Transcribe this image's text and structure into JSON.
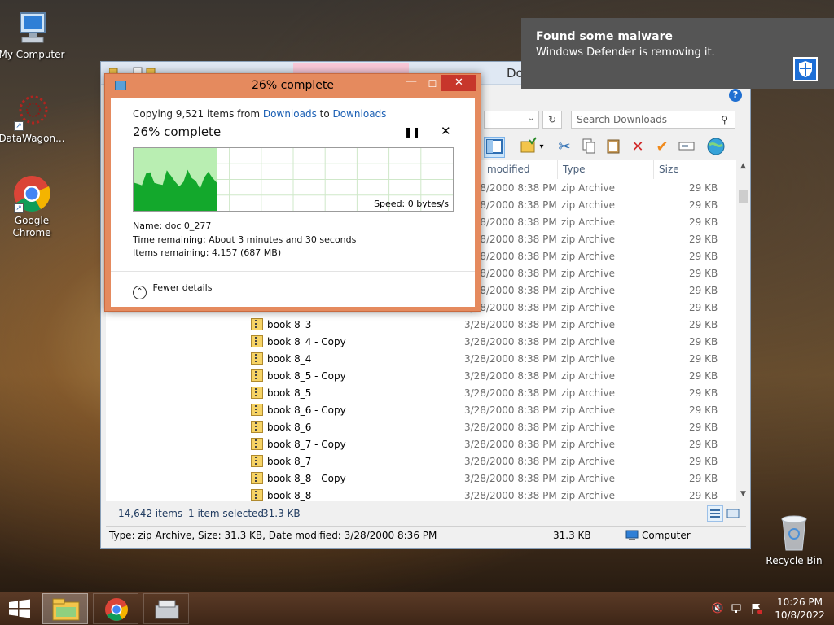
{
  "desktop": {
    "icons": [
      {
        "label": "My Computer"
      },
      {
        "label": "DataWagon..."
      },
      {
        "label": "Google Chrome"
      },
      {
        "label": "Recycle Bin"
      }
    ]
  },
  "explorer": {
    "title": "Do",
    "search_placeholder": "Search Downloads",
    "columns": {
      "date": "modified",
      "type": "Type",
      "size": "Size"
    },
    "top_rows": [
      {
        "date": "3/28/2000 8:38 PM",
        "type": "zip Archive",
        "size": "29 KB"
      },
      {
        "date": "3/28/2000 8:38 PM",
        "type": "zip Archive",
        "size": "29 KB"
      },
      {
        "date": "3/28/2000 8:38 PM",
        "type": "zip Archive",
        "size": "29 KB"
      },
      {
        "date": "3/28/2000 8:38 PM",
        "type": "zip Archive",
        "size": "29 KB"
      },
      {
        "date": "3/28/2000 8:38 PM",
        "type": "zip Archive",
        "size": "29 KB"
      },
      {
        "date": "3/28/2000 8:38 PM",
        "type": "zip Archive",
        "size": "29 KB"
      },
      {
        "date": "3/28/2000 8:38 PM",
        "type": "zip Archive",
        "size": "29 KB"
      },
      {
        "date": "3/28/2000 8:38 PM",
        "type": "zip Archive",
        "size": "29 KB"
      }
    ],
    "rows": [
      {
        "name": "book 8_3",
        "date": "3/28/2000 8:38 PM",
        "type": "zip Archive",
        "size": "29 KB"
      },
      {
        "name": "book 8_4 - Copy",
        "date": "3/28/2000 8:38 PM",
        "type": "zip Archive",
        "size": "29 KB"
      },
      {
        "name": "book 8_4",
        "date": "3/28/2000 8:38 PM",
        "type": "zip Archive",
        "size": "29 KB"
      },
      {
        "name": "book 8_5 - Copy",
        "date": "3/28/2000 8:38 PM",
        "type": "zip Archive",
        "size": "29 KB"
      },
      {
        "name": "book 8_5",
        "date": "3/28/2000 8:38 PM",
        "type": "zip Archive",
        "size": "29 KB"
      },
      {
        "name": "book 8_6 - Copy",
        "date": "3/28/2000 8:38 PM",
        "type": "zip Archive",
        "size": "29 KB"
      },
      {
        "name": "book 8_6",
        "date": "3/28/2000 8:38 PM",
        "type": "zip Archive",
        "size": "29 KB"
      },
      {
        "name": "book 8_7 - Copy",
        "date": "3/28/2000 8:38 PM",
        "type": "zip Archive",
        "size": "29 KB"
      },
      {
        "name": "book 8_7",
        "date": "3/28/2000 8:38 PM",
        "type": "zip Archive",
        "size": "29 KB"
      },
      {
        "name": "book 8_8 - Copy",
        "date": "3/28/2000 8:38 PM",
        "type": "zip Archive",
        "size": "29 KB"
      },
      {
        "name": "book 8_8",
        "date": "3/28/2000 8:38 PM",
        "type": "zip Archive",
        "size": "29 KB"
      }
    ],
    "status": {
      "items": "14,642 items",
      "selected": "1 item selected",
      "selected_size": "31.3 KB"
    },
    "details_bar": {
      "info": "Type: zip Archive, Size: 31.3 KB, Date modified: 3/28/2000 8:36 PM",
      "size": "31.3 KB",
      "location": "Computer"
    }
  },
  "copy_dialog": {
    "title": "26% complete",
    "copying_prefix": "Copying 9,521 items from",
    "source": "Downloads",
    "to_word": "to",
    "destination": "Downloads",
    "percent_text": "26% complete",
    "progress": 0.26,
    "speed": "Speed: 0 bytes/s",
    "name_label": "Name:",
    "name_value": "doc 0_277",
    "time_label": "Time remaining:",
    "time_value": "About 3 minutes and 30 seconds",
    "items_label": "Items remaining:",
    "items_value": "4,157 (687 MB)",
    "fewer_details": "Fewer details"
  },
  "toast": {
    "title": "Found some malware",
    "message": "Windows Defender is removing it."
  },
  "taskbar": {
    "time": "10:26 PM",
    "date": "10/8/2022"
  },
  "colors": {
    "dialog_frame": "#e58a5e",
    "link": "#1a5fb4",
    "progress_fill": "#b9eeb2",
    "graph_fill": "#13a82c",
    "toast_bg": "#555555"
  }
}
